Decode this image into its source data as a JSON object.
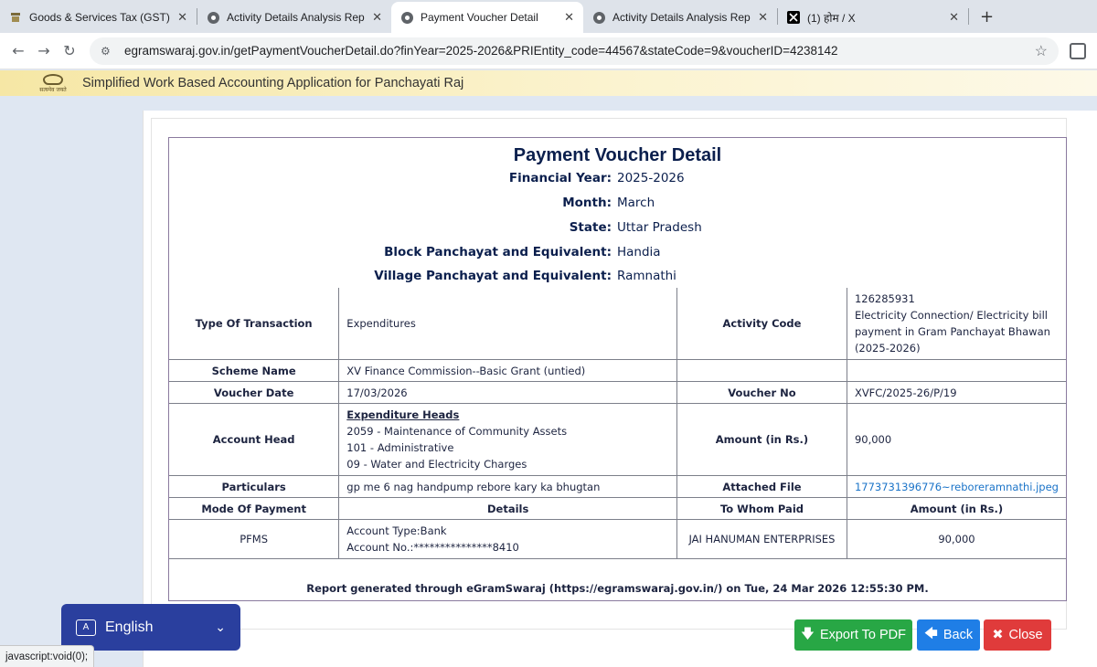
{
  "browser": {
    "tabs": [
      {
        "title": "Goods & Services Tax (GST) | Se",
        "active": false
      },
      {
        "title": "Activity Details Analysis Report",
        "active": false
      },
      {
        "title": "Payment Voucher Detail",
        "active": true
      },
      {
        "title": "Activity Details Analysis Report",
        "active": false
      },
      {
        "title": "(1) होम / X",
        "active": false
      }
    ],
    "url": "egramswaraj.gov.in/getPaymentVoucherDetail.do?finYear=2025-2026&PRIEntity_code=44567&stateCode=9&voucherID=4238142"
  },
  "site": {
    "tagline": "Simplified Work Based Accounting Application for Panchayati Raj",
    "emblem_label": "सत्यमेव जयते"
  },
  "voucher": {
    "title": "Payment Voucher Detail",
    "info": [
      {
        "label": "Financial Year:",
        "value": "2025-2026"
      },
      {
        "label": "Month:",
        "value": "March"
      },
      {
        "label": "State:",
        "value": "Uttar Pradesh"
      },
      {
        "label": "Block Panchayat and Equivalent:",
        "value": "Handia"
      },
      {
        "label": "Village Panchayat and Equivalent:",
        "value": "Ramnathi"
      }
    ],
    "labels": {
      "type_of_transaction": "Type Of Transaction",
      "activity_code": "Activity Code",
      "scheme_name": "Scheme Name",
      "voucher_date": "Voucher Date",
      "voucher_no": "Voucher No",
      "account_head": "Account Head",
      "amount": "Amount (in Rs.)",
      "particulars": "Particulars",
      "attached_file": "Attached File",
      "mode_of_payment": "Mode Of Payment",
      "details": "Details",
      "to_whom_paid": "To Whom Paid",
      "amount_rs": "Amount (in Rs.)"
    },
    "values": {
      "type_of_transaction": "Expenditures",
      "activity_code_lines": [
        "126285931",
        "Electricity Connection/ Electricity bill",
        "payment in Gram Panchayat Bhawan",
        "(2025-2026)"
      ],
      "scheme_name": "XV Finance Commission--Basic Grant (untied)",
      "voucher_date": "17/03/2026",
      "voucher_no": "XVFC/2025-26/P/19",
      "expenditure_heads_title": "Expenditure Heads",
      "account_head_lines": [
        "2059 - Maintenance of Community Assets",
        "101 - Administrative",
        "09 - Water and Electricity Charges"
      ],
      "amount": "90,000",
      "particulars": "gp me 6 nag handpump rebore kary ka bhugtan",
      "attached_file": "1773731396776~reboreramnathi.jpeg",
      "mode_of_payment": "PFMS",
      "account_type": "Account Type:Bank",
      "account_no": "Account No.:***************8410",
      "to_whom_paid": "JAI HANUMAN ENTERPRISES",
      "paid_amount": "90,000"
    },
    "report_note": "Report generated through eGramSwaraj (https://egramswaraj.gov.in/) on Tue, 24 Mar 2026 12:55:30 PM."
  },
  "buttons": {
    "export_pdf": "Export To PDF",
    "back": "Back",
    "close": "Close"
  },
  "language": {
    "selected": "English"
  },
  "status_bar": "javascript:void(0);"
}
